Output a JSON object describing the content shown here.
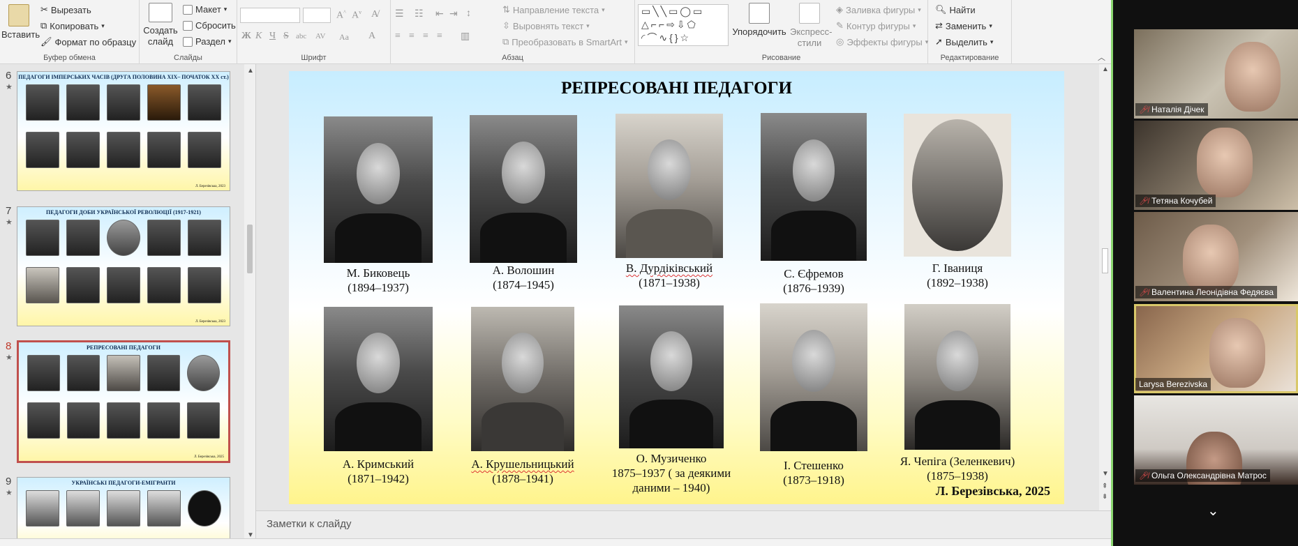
{
  "ribbon": {
    "clipboard": {
      "paste": "Вставить",
      "cut": "Вырезать",
      "copy": "Копировать",
      "format_painter": "Формат по образцу",
      "label": "Буфер обмена"
    },
    "slides": {
      "new_slide": "Создать слайд",
      "layout": "Макет",
      "reset": "Сбросить",
      "section": "Раздел",
      "label": "Слайды"
    },
    "font": {
      "label": "Шрифт",
      "bold": "Ж",
      "italic": "К",
      "underline": "Ч",
      "strike": "S",
      "shadow": "abc",
      "spacing": "AV",
      "case": "Aa",
      "color": "A"
    },
    "paragraph": {
      "text_direction": "Направление текста",
      "align_text": "Выровнять текст",
      "smartart": "Преобразовать в SmartArt",
      "label": "Абзац"
    },
    "drawing": {
      "arrange": "Упорядочить",
      "quick_styles": "Экспресс-стили",
      "fill": "Заливка фигуры",
      "outline": "Контур фигуры",
      "effects": "Эффекты фигуры",
      "label": "Рисование"
    },
    "editing": {
      "find": "Найти",
      "replace": "Заменить",
      "select": "Выделить",
      "label": "Редактирование"
    }
  },
  "thumbnails": [
    {
      "num": "6",
      "title": "ПЕДАГОГИ ІМПЕРСЬКИХ ЧАСІВ (ДРУГА ПОЛОВИНА XIX– ПОЧАТОК XX ст.)",
      "sig": "Л. Березівська, 2023"
    },
    {
      "num": "7",
      "title": "ПЕДАГОГИ ДОБИ УКРАЇНСЬКОЇ РЕВОЛЮЦІЇ (1917-1921)",
      "sig": "Л. Березівська, 2023"
    },
    {
      "num": "8",
      "title": "РЕПРЕСОВАНІ ПЕДАГОГИ",
      "sig": "Л. Березівська, 2025"
    },
    {
      "num": "9",
      "title": "УКРАЇНСЬКІ ПЕДАГОГИ-ЕМІГРАНТИ",
      "sig": ""
    }
  ],
  "slide": {
    "title": "РЕПРЕСОВАНІ ПЕДАГОГИ",
    "signature": "Л. Березівська, 2025",
    "people": [
      {
        "name": "М. Биковець",
        "years": "(1894–1937)"
      },
      {
        "name": "А. Волошин",
        "years": "(1874–1945)"
      },
      {
        "name": "В. Дурдіківський",
        "years": "(1871–1938)"
      },
      {
        "name": "С. Єфремов",
        "years": "(1876–1939)"
      },
      {
        "name": "Г. Іваниця",
        "years": "(1892–1938)"
      },
      {
        "name": "А. Кримський",
        "years": "(1871–1942)"
      },
      {
        "name": "А. Крушельницький",
        "years": "(1878–1941)"
      },
      {
        "name": "О. Музиченко",
        "years": "1875–1937 ( за деякими даними – 1940)"
      },
      {
        "name": "І. Стешенко",
        "years": "(1873–1918)"
      },
      {
        "name": "Я. Чепіга (Зеленкевич)",
        "years": "(1875–1938)"
      }
    ]
  },
  "notes": {
    "placeholder": "Заметки к слайду"
  },
  "video": {
    "participants": [
      {
        "name": "Наталія Дічек",
        "muted": true
      },
      {
        "name": "Тетяна Кочубей",
        "muted": true
      },
      {
        "name": "Валентина Леонідівна Федяєва",
        "muted": true
      },
      {
        "name": "Larysa Berezivska",
        "muted": false
      },
      {
        "name": "Ольга Олександрівна Матрос",
        "muted": true
      }
    ]
  }
}
